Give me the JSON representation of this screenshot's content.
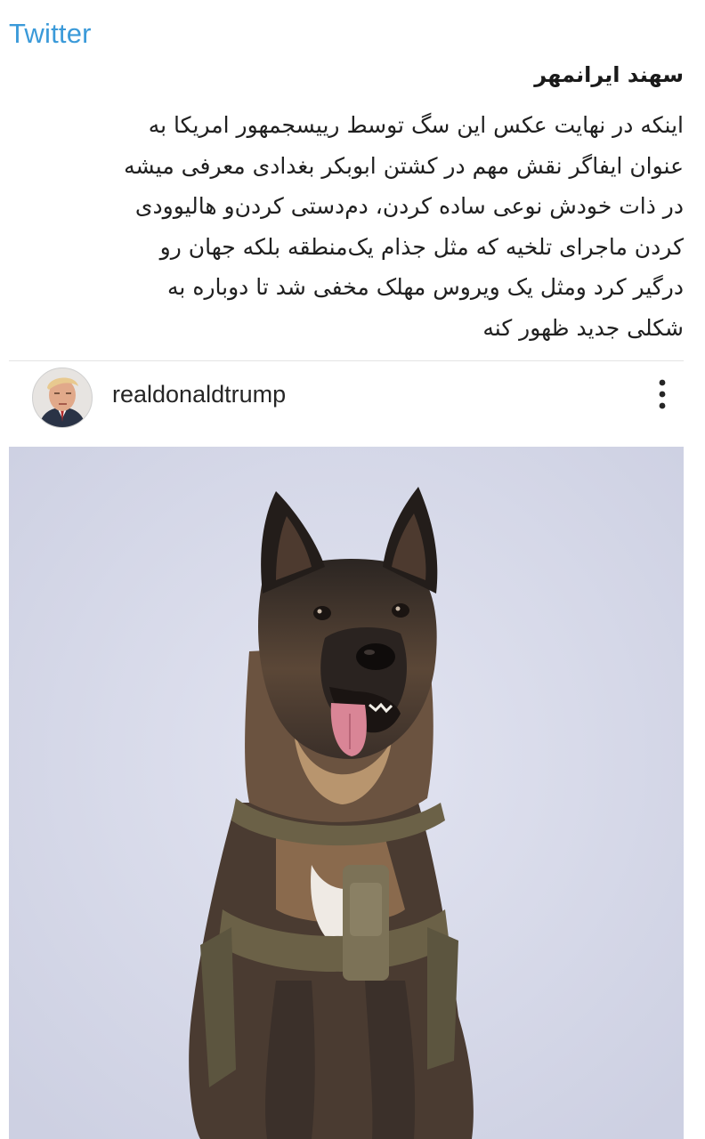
{
  "app": {
    "source_label": "Twitter"
  },
  "post": {
    "author": "سهند ایرانمهر",
    "lines": [
      "اینکه در نهایت عکس این سگ توسط رییسجمهور امریکا به",
      "عنوان ایفاگر نقش مهم در کشتن ابوبکر بغدادی معرفی میشه",
      "در ذات خودش نوعی ساده کردن، دم‌دستی کردن‌و هالیوودی",
      "کردن ماجرای تلخیه که مثل جذام یک‌منطقه بلکه جهان رو",
      "درگیر کرد ومثل یک ویروس مهلک مخفی شد تا دوباره به",
      "شکلی جدید ظهور کنه"
    ]
  },
  "embedded_post": {
    "username": "realdonaldtrump",
    "avatar_icon": "profile-photo",
    "more_icon": "vertical-ellipsis-icon",
    "image_subject": "dog-photo"
  },
  "colors": {
    "twitter_label": "#3b9ad9",
    "text": "#1f1f1f",
    "photo_background": "#d9dcea"
  }
}
